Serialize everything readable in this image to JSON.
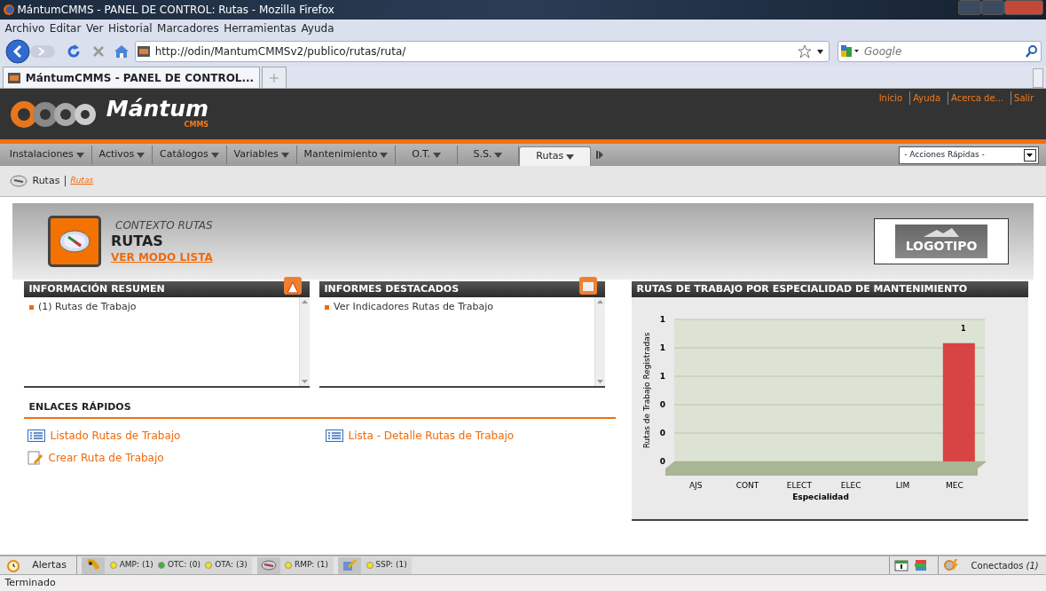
{
  "window": {
    "title": "MántumCMMS - PANEL DE CONTROL: Rutas - Mozilla Firefox"
  },
  "menu_bar": [
    "Archivo",
    "Editar",
    "Ver",
    "Historial",
    "Marcadores",
    "Herramientas",
    "Ayuda"
  ],
  "address_bar": {
    "url": "http://odin/MantumCMMSv2/publico/rutas/ruta/"
  },
  "search_box": {
    "placeholder": "Google"
  },
  "browser_tabs": [
    {
      "label": "MántumCMMS - PANEL DE CONTROL...",
      "selected": true
    }
  ],
  "app_header": {
    "logo_text": "Mántum",
    "logo_subtext": "CMMS",
    "links": [
      "Inicio",
      "Ayuda",
      "Acerca de...",
      "Salir"
    ]
  },
  "main_menu": [
    {
      "label": "Instalaciones",
      "selected": false
    },
    {
      "label": "Activos",
      "selected": false
    },
    {
      "label": "Catálogos",
      "selected": false
    },
    {
      "label": "Variables",
      "selected": false
    },
    {
      "label": "Mantenimiento",
      "selected": false
    },
    {
      "label": "O.T.",
      "selected": false
    },
    {
      "label": "S.S.",
      "selected": false
    },
    {
      "label": "Rutas",
      "selected": true
    }
  ],
  "quick_actions": {
    "value": "- Acciones Rápidas -"
  },
  "breadcrumb": {
    "current": "Rutas",
    "link": "Rutas"
  },
  "context": {
    "subtitle": "CONTEXTO RUTAS",
    "title": "RUTAS",
    "link": "VER MODO LISTA",
    "logo_text": "LOGOTIPO"
  },
  "panels": [
    {
      "title": "INFORMACIÓN RESUMEN",
      "items": [
        "(1) Rutas de Trabajo"
      ]
    },
    {
      "title": "INFORMES DESTACADOS",
      "items": [
        "Ver Indicadores Rutas de Trabajo"
      ]
    }
  ],
  "quick_links": {
    "title": "ENLACES RÁPIDOS",
    "items": [
      {
        "label": "Listado Rutas de Trabajo",
        "kind": "list"
      },
      {
        "label": "Lista - Detalle Rutas de Trabajo",
        "kind": "list"
      },
      {
        "label": "Crear Ruta de Trabajo",
        "kind": "create"
      }
    ]
  },
  "chart_panel": {
    "title": "RUTAS DE TRABAJO POR ESPECIALIDAD DE MANTENIMIENTO",
    "chart_data": {
      "type": "bar",
      "xlabel": "Especialidad",
      "ylabel": "Rutas de Trabajo Registradas",
      "categories": [
        "AJS",
        "CONT",
        "ELECT",
        "ELEC",
        "LIM",
        "MEC"
      ],
      "series": [
        {
          "color": "#d84444",
          "values": [
            0,
            0,
            0,
            0,
            0,
            1
          ]
        }
      ],
      "grid": true,
      "ylim": [
        0,
        1.2
      ],
      "yticks": [
        {
          "value": 0,
          "label": "0"
        },
        {
          "value": 0.24,
          "label": "0"
        },
        {
          "value": 0.48,
          "label": "0"
        },
        {
          "value": 0.72,
          "label": "1"
        },
        {
          "value": 0.96,
          "label": "1"
        },
        {
          "value": 1.2,
          "label": "1"
        }
      ],
      "value_labels": [
        null,
        null,
        null,
        null,
        null,
        "1"
      ]
    }
  },
  "alerts_bar": {
    "label": "Alertas",
    "groups": [
      {
        "kind": "ot",
        "items": [
          {
            "label": "AMP: (1)",
            "color": "#f2e21a"
          },
          {
            "label": "OTC: (0)",
            "color": "#3fb03f"
          },
          {
            "label": "OTA: (3)",
            "color": "#f2e21a"
          }
        ]
      },
      {
        "kind": "route",
        "items": [
          {
            "label": "RMP: (1)",
            "color": "#f2e21a"
          }
        ]
      },
      {
        "kind": "request",
        "items": [
          {
            "label": "SSP: (1)",
            "color": "#f2e21a"
          }
        ]
      }
    ],
    "connected": "Conectados *(1)*"
  },
  "status_bar": {
    "text": "Terminado"
  }
}
